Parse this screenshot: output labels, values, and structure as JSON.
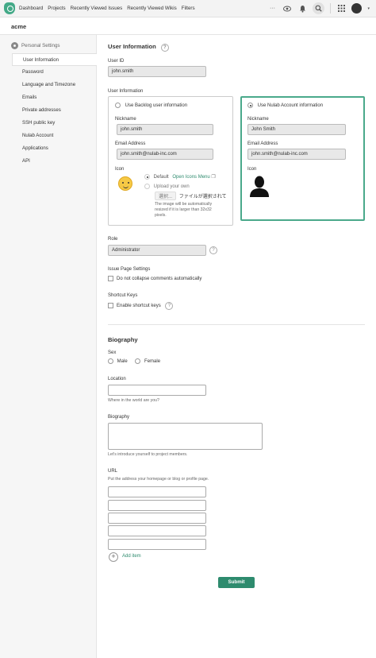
{
  "topbar": {
    "nav": [
      "Dashboard",
      "Projects",
      "Recently Viewed Issues",
      "Recently Viewed Wikis",
      "Filters"
    ],
    "more": "···"
  },
  "space": {
    "name": "acme"
  },
  "sidebar": {
    "heading": "Personal Settings",
    "items": [
      "User Information",
      "Password",
      "Language and Timezone",
      "Emails",
      "Private addresses",
      "SSH public key",
      "Nulab Account",
      "Applications",
      "API"
    ]
  },
  "user_info": {
    "title": "User Information",
    "help": "?",
    "user_id_label": "User ID",
    "user_id_value": "john.smith",
    "section_label": "User Information",
    "backlog": {
      "option_label": "Use Backlog user information",
      "nickname_label": "Nickname",
      "nickname_value": "john.smith",
      "email_label": "Email Address",
      "email_value": "john.smith@nulab-inc.com",
      "icon_label": "Icon",
      "default_label": "Default",
      "icons_menu": "Open Icons Menu",
      "upload_label": "Upload your own",
      "choose_button": "選択...",
      "no_file": "ファイルが選択されて",
      "resize_note_1": "The image will be automatically",
      "resize_note_2": "resized if it is larger than 32x32",
      "resize_note_3": "pixels."
    },
    "nulab": {
      "option_label": "Use Nulab Account information",
      "nickname_label": "Nickname",
      "nickname_value": "John Smith",
      "email_label": "Email Address",
      "email_value": "john.smith@nulab-inc.com",
      "icon_label": "Icon"
    },
    "role_label": "Role",
    "role_value": "Administrator",
    "issue_page_label": "Issue Page Settings",
    "no_collapse_label": "Do not collapse comments automatically",
    "shortcut_label": "Shortcut Keys",
    "enable_shortcut_label": "Enable shortcut keys"
  },
  "biography": {
    "title": "Biography",
    "sex_label": "Sex",
    "male": "Male",
    "female": "Female",
    "location_label": "Location",
    "location_hint": "Where in the world are you?",
    "bio_label": "Biography",
    "bio_hint": "Let's introduce yourself to project members.",
    "url_label": "URL",
    "url_hint": "Put the address your homepage or blog or profile page.",
    "add_item": "Add item",
    "add_symbol": "+"
  },
  "submit_label": "Submit",
  "colors": {
    "accent": "#2e8b6e",
    "selected_border": "#4aa98b"
  },
  "icons": [
    "backlog-logo-icon",
    "more-icon",
    "watch-icon",
    "bell-icon",
    "search-icon",
    "apps-grid-icon",
    "avatar-icon",
    "gear-icon",
    "smiley-icon",
    "silhouette-icon",
    "help-icon",
    "plus-icon",
    "window-icon"
  ]
}
